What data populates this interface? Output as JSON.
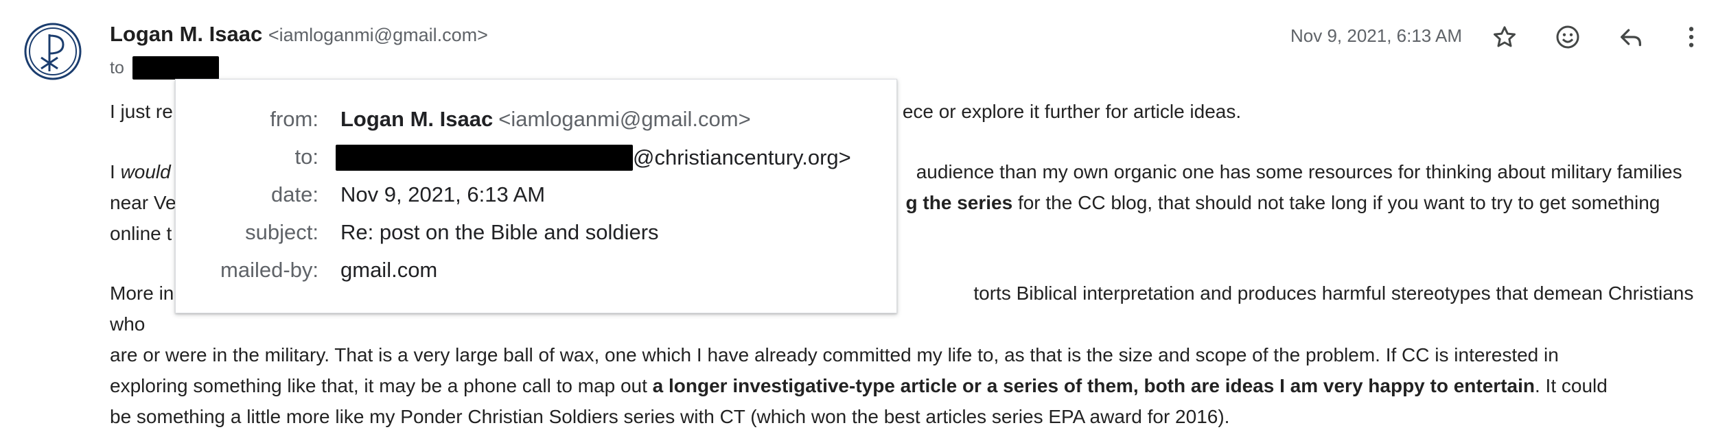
{
  "header": {
    "sender_name": "Logan M. Isaac",
    "sender_email": "<iamloganmi@gmail.com>",
    "to_label": "to",
    "date": "Nov 9, 2021, 6:13 AM"
  },
  "actions": {
    "star_icon": "star-icon",
    "emoji_icon": "emoji-icon",
    "reply_icon": "reply-icon",
    "more_icon": "more-vert-icon"
  },
  "body": {
    "p1_start": "I just re",
    "p1_end": "ece or explore it further for article ideas.",
    "p2_line1_start": "I ",
    "p2_line1_italic": "would",
    "p2_line1_end": "audience than my own organic one has some resources for thinking about military families",
    "p2_line2_start": "near Ve",
    "p2_line2_bold": "g the series",
    "p2_line2_end": " for the CC blog, that should not take long if you want to try to get something",
    "p2_line3_start": "online t",
    "p3_line1_start": "More in",
    "p3_line1_end": "torts Biblical interpretation and produces harmful stereotypes that demean Christians who",
    "p3_line2": "are or were in the military. That is a very large ball of wax, one which I have already committed my life to, as that is the size and scope of the problem. If CC is interested in",
    "p3_line3_start": "exploring something like that, it may be a phone call to map out ",
    "p3_line3_bold": "a longer investigative-type article or a series of them, both are ideas I am very happy to entertain",
    "p3_line3_end": ". It could",
    "p3_line4": "be something a little more like my Ponder Christian Soldiers series with CT (which won the best articles series EPA award for 2016)."
  },
  "details_popup": {
    "from_label": "from:",
    "from_name": "Logan M. Isaac",
    "from_email": "<iamloganmi@gmail.com>",
    "to_label": "to:",
    "to_domain": "@christiancentury.org>",
    "date_label": "date:",
    "date_value": "Nov 9, 2021, 6:13 AM",
    "subject_label": "subject:",
    "subject_value": "Re: post on the Bible and soldiers",
    "mailedby_label": "mailed-by:",
    "mailedby_value": "gmail.com"
  }
}
